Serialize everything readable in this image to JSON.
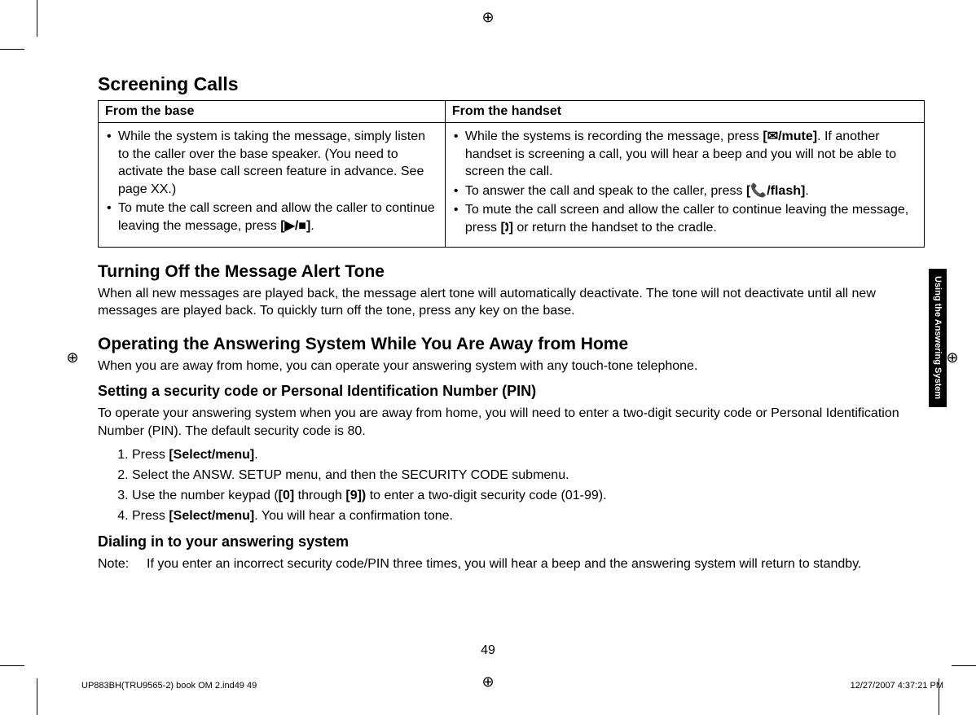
{
  "section1": {
    "heading": "Screening Calls",
    "table": {
      "head_left": "From the base",
      "head_right": "From the handset",
      "left_b1": "While the system is taking the message, simply listen to the caller over the base speaker. (You need to activate the base call screen feature in advance. See page XX.)",
      "left_b2_a": "To mute the call screen and allow the caller to continue leaving the message, press ",
      "left_b2_sym": "[▶/■]",
      "left_b2_b": ".",
      "right_b1_a": "While the systems is recording the message, press ",
      "right_b1_sym": "[✉/mute]",
      "right_b1_b": ". If another handset is screening a call, you will hear a beep and you will not be able to screen the call.",
      "right_b2_a": "To answer the call and speak to the caller, press ",
      "right_b2_sym": "[📞/flash]",
      "right_b2_b": ".",
      "right_b3_a": "To mute the call screen and allow the caller to continue leaving the message, press ",
      "right_b3_sym": "[🕽]",
      "right_b3_b": " or return the handset to the cradle."
    }
  },
  "section2": {
    "heading": "Turning Off the Message Alert Tone",
    "para": "When all new messages are played back, the message alert tone will automatically deactivate. The tone will not deactivate until all new messages are played back. To quickly turn off the tone, press any key on the base."
  },
  "section3": {
    "heading": "Operating the Answering System While You Are Away from Home",
    "para": "When you are away from home, you can operate your answering system with any touch-tone telephone.",
    "sub1": {
      "heading": "Setting a security code or Personal Identification Number (PIN)",
      "para": "To operate your answering system when you are away from home, you will need to enter a two-digit security code or Personal Identification Number (PIN). The default security code is 80.",
      "step1_a": "Press ",
      "step1_b": "[Select/menu]",
      "step1_c": ".",
      "step2": "Select the ANSW. SETUP menu, and then the SECURITY CODE submenu.",
      "step3_a": "Use the number keypad (",
      "step3_b": "[0]",
      "step3_c": " through ",
      "step3_d": "[9])",
      "step3_e": " to enter a two-digit security code (01-99).",
      "step4_a": "Press ",
      "step4_b": "[Select/menu]",
      "step4_c": ". You will hear a confirmation tone."
    },
    "sub2": {
      "heading": "Dialing in to your answering system",
      "note_label": "Note:",
      "note_text": "If you enter an incorrect security code/PIN three times, you will hear a beep and the answering system will return to standby."
    }
  },
  "side_tab": "Using the Answering System",
  "page_num": "49",
  "footer_left": "UP883BH(TRU9565-2) book OM 2.ind49   49",
  "footer_right": "12/27/2007   4:37:21 PM"
}
